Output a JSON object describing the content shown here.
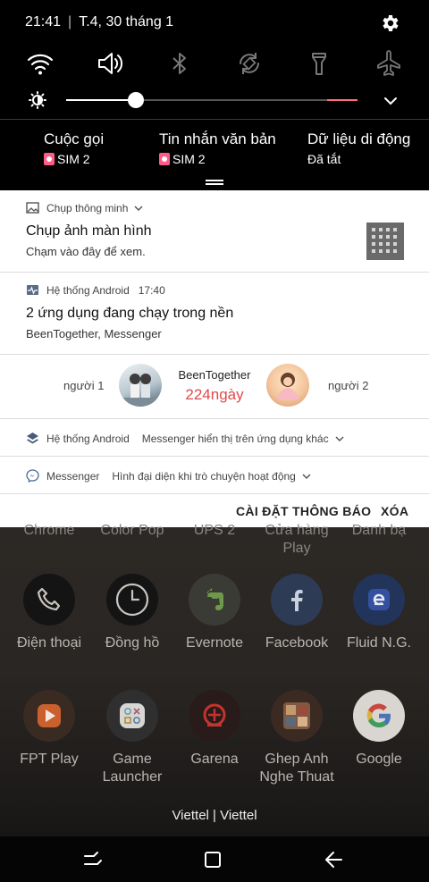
{
  "status_bar": {
    "time": "21:41",
    "separator": "|",
    "date": "T.4, 30 tháng 1"
  },
  "quick_settings": {
    "toggles": [
      {
        "name": "wifi",
        "active": true
      },
      {
        "name": "sound",
        "active": true
      },
      {
        "name": "bluetooth",
        "active": false
      },
      {
        "name": "auto-rotate",
        "active": false
      },
      {
        "name": "flashlight",
        "active": false
      },
      {
        "name": "airplane-mode",
        "active": false
      }
    ],
    "brightness_level": 0.24
  },
  "sim_info": [
    {
      "title": "Cuộc gọi",
      "subtitle": "SIM 2",
      "badge": true
    },
    {
      "title": "Tin nhắn văn bản",
      "subtitle": "SIM 2",
      "badge": true
    },
    {
      "title": "Dữ liệu di động",
      "subtitle": "Đã tắt",
      "badge": false
    }
  ],
  "notifications": {
    "screenshot": {
      "app": "Chụp thông minh",
      "title": "Chụp ảnh màn hình",
      "text": "Chạm vào đây để xem."
    },
    "android_system": {
      "app": "Hệ thống Android",
      "time": "17:40",
      "title": "2 ứng dụng đang chạy trong nền",
      "text": "BeenTogether, Messenger"
    },
    "been_together": {
      "person1": "người 1",
      "person2": "người 2",
      "app": "BeenTogether",
      "days": "224ngày"
    },
    "android_overlay": {
      "app": "Hệ thống Android",
      "text": "Messenger hiển thị trên ứng dụng khác"
    },
    "messenger": {
      "app": "Messenger",
      "text": "Hình đại diện khi trò chuyện hoạt động"
    },
    "actions": {
      "settings": "CÀI ĐẶT THÔNG BÁO",
      "clear": "XÓA"
    }
  },
  "home": {
    "faded_labels": [
      "Chrome",
      "Color Pop",
      "UPS 2",
      "Cửa hàng\nPlay",
      "Danh bạ"
    ],
    "row1": [
      {
        "label": "Điện thoại",
        "icon": "phone-icon"
      },
      {
        "label": "Đồng hồ",
        "icon": "clock-icon"
      },
      {
        "label": "Evernote",
        "icon": "evernote-icon"
      },
      {
        "label": "Facebook",
        "icon": "facebook-icon"
      },
      {
        "label": "Fluid N.G.",
        "icon": "fluid-ng-icon"
      }
    ],
    "row2": [
      {
        "label": "FPT Play",
        "icon": "fpt-play-icon"
      },
      {
        "label": "Game\nLauncher",
        "icon": "game-launcher-icon"
      },
      {
        "label": "Garena",
        "icon": "garena-icon"
      },
      {
        "label": "Ghep Anh\nNghe Thuat",
        "icon": "ghep-anh-icon"
      },
      {
        "label": "Google",
        "icon": "google-icon"
      }
    ],
    "carrier": "Viettel | Viettel"
  },
  "colors": {
    "accent_pink": "#ff6b81",
    "days_red": "#e04a4a",
    "panel_black": "#000000",
    "card_white": "#ffffff"
  }
}
